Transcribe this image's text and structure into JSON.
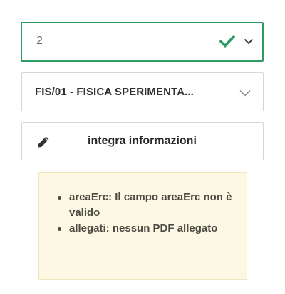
{
  "select_number": {
    "value": "2",
    "valid": true,
    "icons": [
      "check-icon",
      "chevron-down-icon"
    ],
    "colors": {
      "border": "#2e9b64",
      "check": "#2e9b64"
    }
  },
  "select_sector": {
    "value": "FIS/01 - FISICA SPERIMENTA...",
    "icons": [
      "chevron-down-icon"
    ]
  },
  "integra_button": {
    "label": "integra informazioni",
    "icon": "pencil-icon"
  },
  "errors": {
    "items": [
      "areaErc: Il campo areaErc non è valido",
      "allegati: nessun PDF allegato"
    ],
    "colors": {
      "background": "#fcf8e4",
      "border": "#efe4bc"
    }
  }
}
